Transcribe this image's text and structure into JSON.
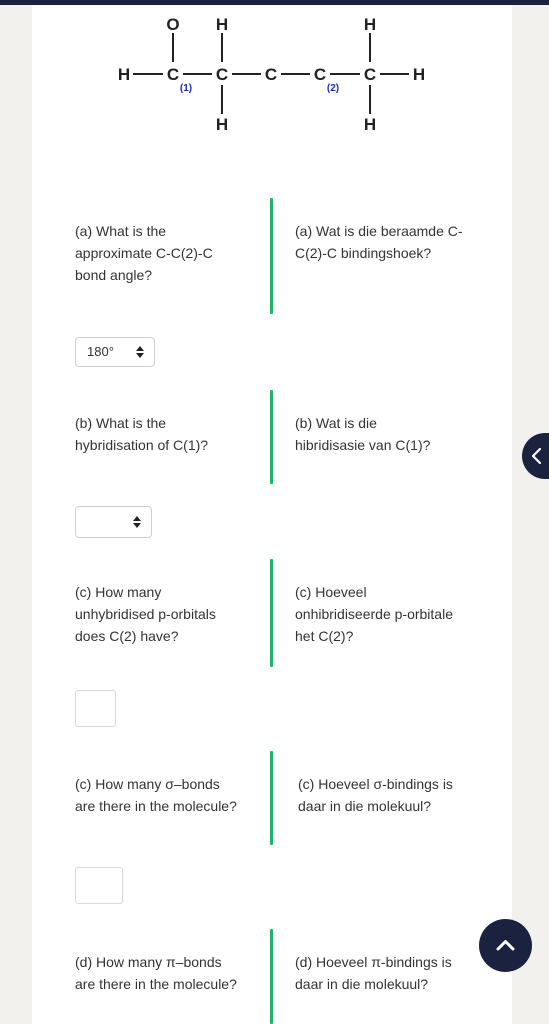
{
  "molecule": {
    "atoms": {
      "o": "O",
      "h_top_3": "H",
      "h_top_6": "H",
      "h_left": "H",
      "c1": "C",
      "c3": "C",
      "c4": "C",
      "c2": "C",
      "c6": "C",
      "h_right": "H",
      "h_bottom_3": "H",
      "h_bottom_6": "H"
    },
    "label_1": "(1)",
    "label_2": "(2)"
  },
  "questions": [
    {
      "en": [
        "(a) What is the",
        "approximate C-C(2)-C",
        "bond angle?"
      ],
      "af": [
        "(a) Wat is die beraamde C-",
        "C(2)-C bindingshoek?"
      ],
      "answer_type": "select",
      "selected": "180°"
    },
    {
      "en": [
        "(b) What is the",
        "hybridisation of C(1)?"
      ],
      "af": [
        "(b) Wat is die",
        "hibridisasie van C(1)?"
      ],
      "answer_type": "select",
      "selected": ""
    },
    {
      "en": [
        "(c) How many",
        "unhybridised p-orbitals",
        "does C(2) have?"
      ],
      "af": [
        "(c) Hoeveel",
        "onhibridiseerde p-orbitale",
        "het C(2)?"
      ],
      "answer_type": "text",
      "value": ""
    },
    {
      "en": [
        "(c) How many σ–bonds",
        "are there in the molecule?"
      ],
      "af": [
        "(c) Hoeveel σ-bindings is",
        "daar in die molekuul?"
      ],
      "answer_type": "text",
      "value": ""
    },
    {
      "en": [
        "(d) How many π–bonds",
        "are there in the molecule?"
      ],
      "af": [
        "(d) Hoeveel π-bindings is",
        "daar in die molekuul?"
      ]
    }
  ],
  "icons": {
    "side_tab": "chevron-left-icon",
    "fab": "chevron-up-icon",
    "select": "select-arrows-icon"
  },
  "colors": {
    "accent_green": "#1fb36b",
    "navy": "#1b2240",
    "label_blue": "#1a2fb0"
  }
}
